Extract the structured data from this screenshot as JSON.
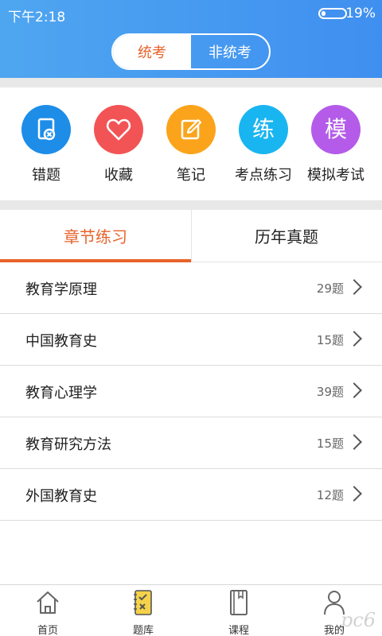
{
  "status_bar": {
    "time": "下午2:18",
    "battery_pct": "19%",
    "battery_level": 0.19
  },
  "segment": {
    "active": "统考",
    "inactive": "非统考"
  },
  "quick_actions": [
    {
      "label": "错题",
      "icon": "wrong-question-icon",
      "color": "#1d8de8"
    },
    {
      "label": "收藏",
      "icon": "heart-icon",
      "color": "#f25456"
    },
    {
      "label": "笔记",
      "icon": "note-edit-icon",
      "color": "#fba41b"
    },
    {
      "label": "考点练习",
      "icon": "lian-char-icon",
      "glyph": "练",
      "color": "#19b5f0"
    },
    {
      "label": "模拟考试",
      "icon": "mo-char-icon",
      "glyph": "模",
      "color": "#b45bea"
    }
  ],
  "tabs": [
    {
      "label": "章节练习",
      "active": true
    },
    {
      "label": "历年真题",
      "active": false
    }
  ],
  "chapters": [
    {
      "title": "教育学原理",
      "count": "29题"
    },
    {
      "title": "中国教育史",
      "count": "15题"
    },
    {
      "title": "教育心理学",
      "count": "39题"
    },
    {
      "title": "教育研究方法",
      "count": "15题"
    },
    {
      "title": "外国教育史",
      "count": "12题"
    }
  ],
  "bottom_nav": [
    {
      "label": "首页",
      "icon": "home-icon"
    },
    {
      "label": "题库",
      "icon": "question-bank-icon"
    },
    {
      "label": "课程",
      "icon": "book-icon"
    },
    {
      "label": "我的",
      "icon": "user-icon"
    }
  ],
  "accent_color": "#e8632b",
  "header_color": "#3f8ff0",
  "watermark": "pc6"
}
